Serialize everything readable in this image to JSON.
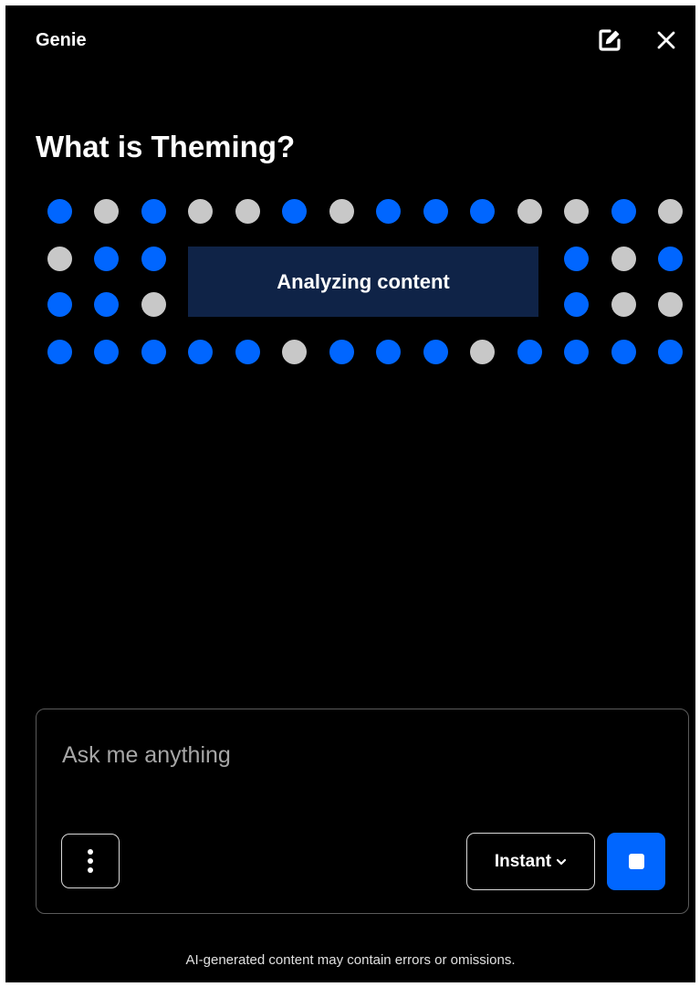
{
  "header": {
    "title": "Genie",
    "icons": [
      "edit-icon",
      "close-icon"
    ]
  },
  "question": {
    "title": "What is Theming?"
  },
  "analyzing": {
    "label": "Analyzing content"
  },
  "dot_grid": {
    "colors": {
      "blue": "#0066ff",
      "grey": "#c8c8c8"
    },
    "rows": [
      [
        "blue",
        "grey",
        "blue",
        "grey",
        "grey",
        "blue",
        "grey",
        "blue",
        "blue",
        "blue",
        "grey",
        "grey",
        "blue",
        "grey"
      ],
      [
        "grey",
        "blue",
        "blue",
        "",
        "",
        "",
        "",
        "",
        "",
        "",
        "",
        "blue",
        "grey",
        "blue"
      ],
      [
        "blue",
        "blue",
        "grey",
        "",
        "",
        "",
        "",
        "",
        "",
        "",
        "",
        "blue",
        "grey",
        "grey"
      ],
      [
        "blue",
        "blue",
        "blue",
        "blue",
        "blue",
        "grey",
        "blue",
        "blue",
        "blue",
        "grey",
        "blue",
        "blue",
        "blue",
        "blue"
      ]
    ]
  },
  "composer": {
    "placeholder": "Ask me anything",
    "mode_label": "Instant",
    "icons": [
      "more-vertical-icon",
      "chevron-down-icon",
      "stop-icon"
    ]
  },
  "footer": {
    "disclaimer": "AI-generated content may contain errors or omissions."
  },
  "theme": {
    "background": "#000000",
    "accent": "#0066ff",
    "status_box": "#0f2347"
  }
}
